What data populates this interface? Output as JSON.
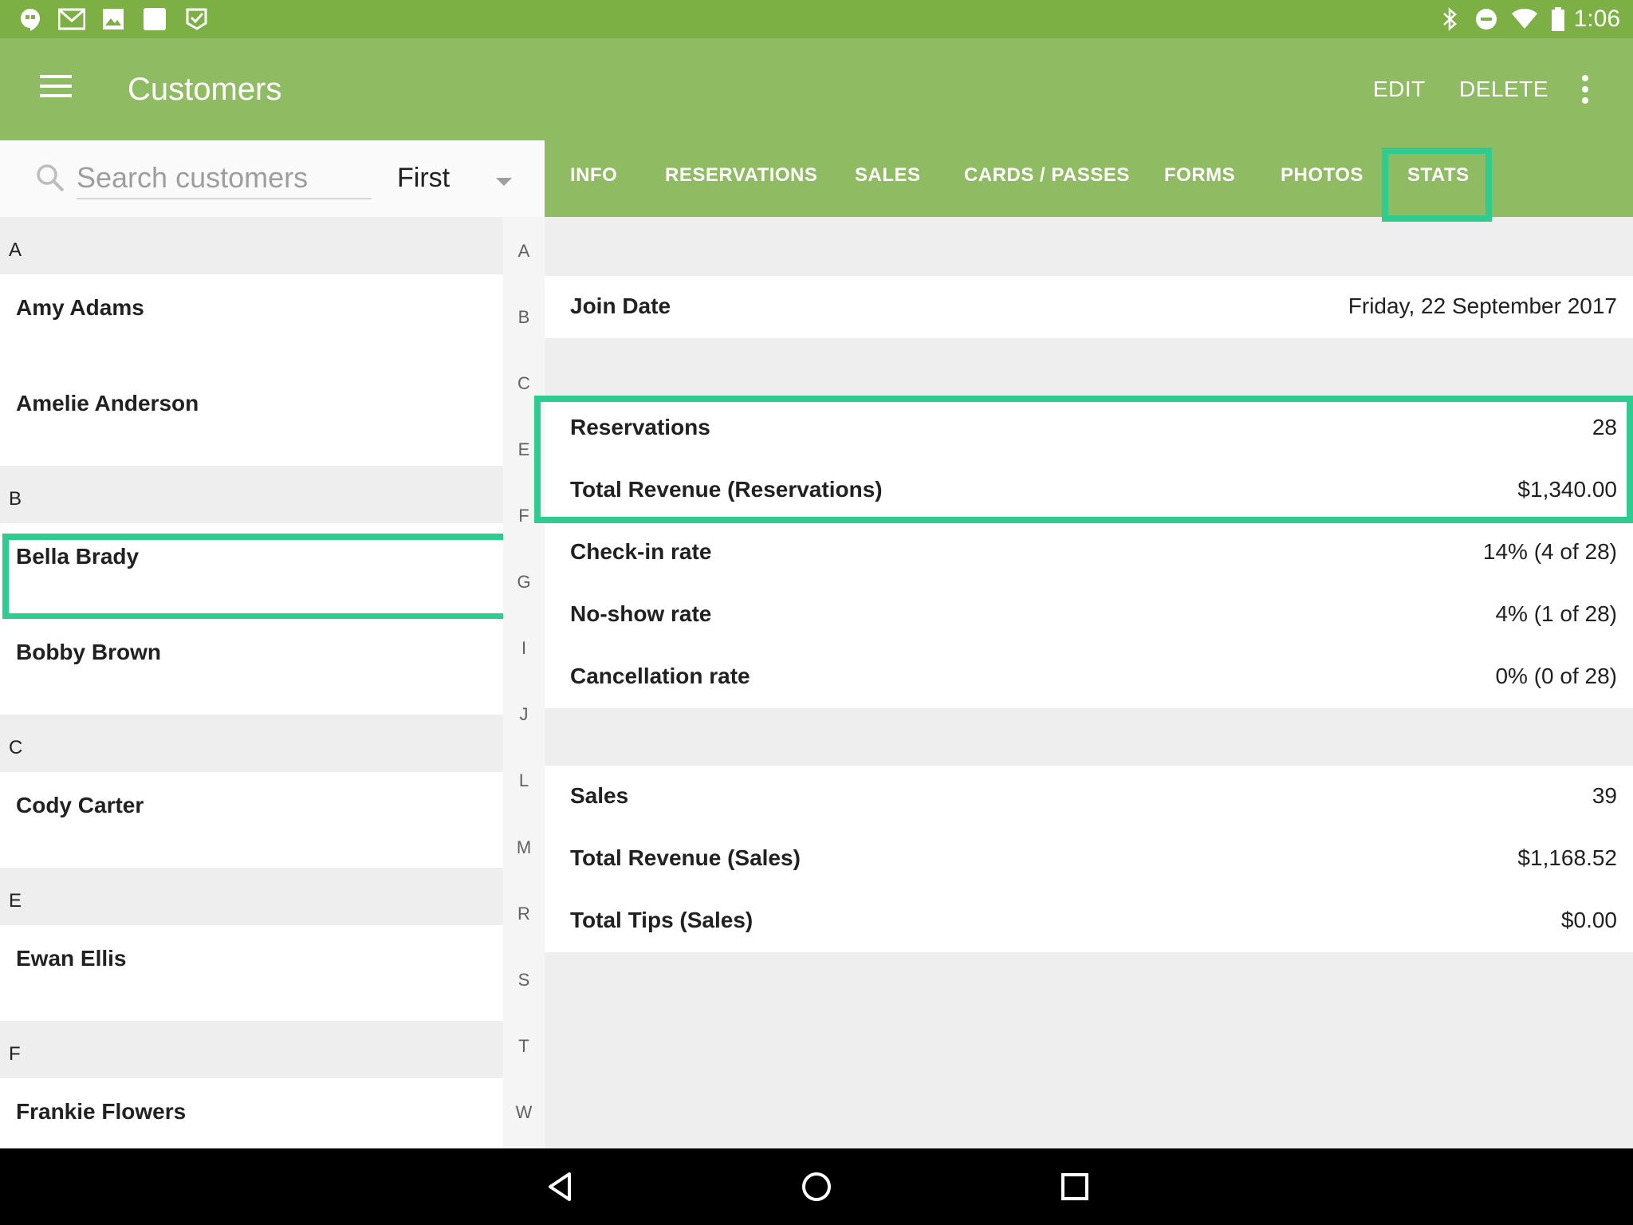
{
  "status_bar": {
    "time": "1:06",
    "left_icons": [
      "hangouts-icon",
      "gmail-icon",
      "photos-icon",
      "square-app-icon",
      "play-store-icon"
    ],
    "right_icons": [
      "bluetooth-icon",
      "do-not-disturb-icon",
      "wifi-icon",
      "battery-icon"
    ]
  },
  "app_bar": {
    "title": "Customers",
    "edit_label": "EDIT",
    "delete_label": "DELETE"
  },
  "search": {
    "placeholder": "Search customers",
    "sort_value": "First"
  },
  "customer_list": [
    {
      "header": "A",
      "names": [
        "Amy Adams",
        "Amelie Anderson"
      ]
    },
    {
      "header": "B",
      "names": [
        "Bella Brady",
        "Bobby Brown"
      ]
    },
    {
      "header": "C",
      "names": [
        "Cody Carter"
      ]
    },
    {
      "header": "E",
      "names": [
        "Ewan Ellis"
      ]
    },
    {
      "header": "F",
      "names": [
        "Frankie Flowers"
      ]
    }
  ],
  "index_letters": [
    "A",
    "B",
    "C",
    "E",
    "F",
    "G",
    "I",
    "J",
    "L",
    "M",
    "R",
    "S",
    "T",
    "W"
  ],
  "tabs": [
    "INFO",
    "RESERVATIONS",
    "SALES",
    "CARDS / PASSES",
    "FORMS",
    "PHOTOS",
    "STATS"
  ],
  "active_tab": "STATS",
  "stats": {
    "join_date": {
      "label": "Join Date",
      "value": "Friday, 22 September 2017"
    },
    "reservations": [
      {
        "label": "Reservations",
        "value": "28"
      },
      {
        "label": "Total Revenue (Reservations)",
        "value": "$1,340.00"
      },
      {
        "label": "Check-in rate",
        "value": "14% (4 of 28)"
      },
      {
        "label": "No-show rate",
        "value": "4% (1 of 28)"
      },
      {
        "label": "Cancellation rate",
        "value": "0% (0 of 28)"
      }
    ],
    "sales": [
      {
        "label": "Sales",
        "value": "39"
      },
      {
        "label": "Total Revenue (Sales)",
        "value": "$1,168.52"
      },
      {
        "label": "Total Tips (Sales)",
        "value": "$0.00"
      }
    ]
  },
  "colors": {
    "status_bar": "#7cb045",
    "app_bar": "#8fbb62",
    "highlight": "#2ecc8f"
  }
}
